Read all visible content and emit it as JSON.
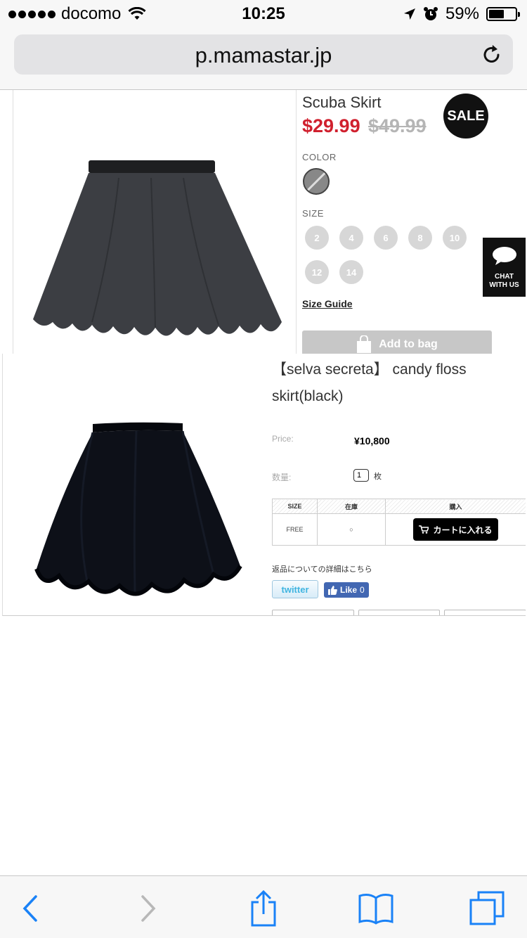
{
  "status_bar": {
    "carrier": "docomo",
    "time": "10:25",
    "battery_percent": "59%",
    "battery_level": 0.59,
    "icons": [
      "signal-dots-icon",
      "wifi-icon",
      "location-arrow-icon",
      "alarm-clock-icon",
      "battery-icon"
    ]
  },
  "browser": {
    "url": "p.mamastar.jp",
    "reload_icon": "reload-icon",
    "toolbar_icons": [
      "back-chevron-icon",
      "forward-chevron-icon",
      "share-icon",
      "bookmarks-icon",
      "tabs-icon"
    ]
  },
  "hm_product": {
    "title": "Scuba Skirt",
    "price": "$29.99",
    "old_price": "$49.99",
    "sale_badge": "SALE",
    "color_label": "COLOR",
    "size_label": "SIZE",
    "sizes": [
      "2",
      "4",
      "6",
      "8",
      "10",
      "12",
      "14"
    ],
    "size_guide": "Size Guide",
    "add_to_bag": "Add to bag",
    "chat_line1": "CHAT",
    "chat_line2": "WITH US",
    "colors": {
      "price_red": "#d0202e",
      "chip_gray": "#d7d7d7"
    }
  },
  "selva_product": {
    "title": "【selva secreta】 candy floss skirt(black)",
    "price_label": "Price:",
    "price": "¥10,800",
    "qty_label": "数量:",
    "qty_value": "1",
    "qty_unit": "枚",
    "table": {
      "headers": [
        "SIZE",
        "在庫",
        "購入"
      ],
      "row": {
        "size": "FREE",
        "stock": "○",
        "cart_label": "カートに入れる"
      }
    },
    "return_note": "返品についての詳細はこちら",
    "twitter_label": "twitter",
    "fb_like_label": "Like",
    "fb_like_count": "0"
  }
}
